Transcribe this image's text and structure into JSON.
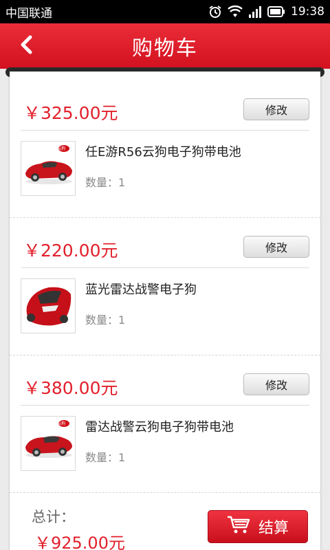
{
  "status_bar": {
    "carrier": "中国联通",
    "time": "19:38"
  },
  "header": {
    "title": "购物车"
  },
  "items": [
    {
      "price": "￥325.00元",
      "edit_label": "修改",
      "name": "任E游R56云狗电子狗带电池",
      "quantity": "数量：1",
      "badge": "云狗"
    },
    {
      "price": "￥220.00元",
      "edit_label": "修改",
      "name": "蓝光雷达战警电子狗",
      "quantity": "数量：1"
    },
    {
      "price": "￥380.00元",
      "edit_label": "修改",
      "name": "雷达战警云狗电子狗带电池",
      "quantity": "数量：1",
      "badge": "云狗"
    }
  ],
  "footer": {
    "total_label": "总计：",
    "total_value": "￥925.00元",
    "checkout_label": "结算"
  },
  "colors": {
    "brand_red": "#d3111f",
    "price_red": "#e2202c"
  }
}
